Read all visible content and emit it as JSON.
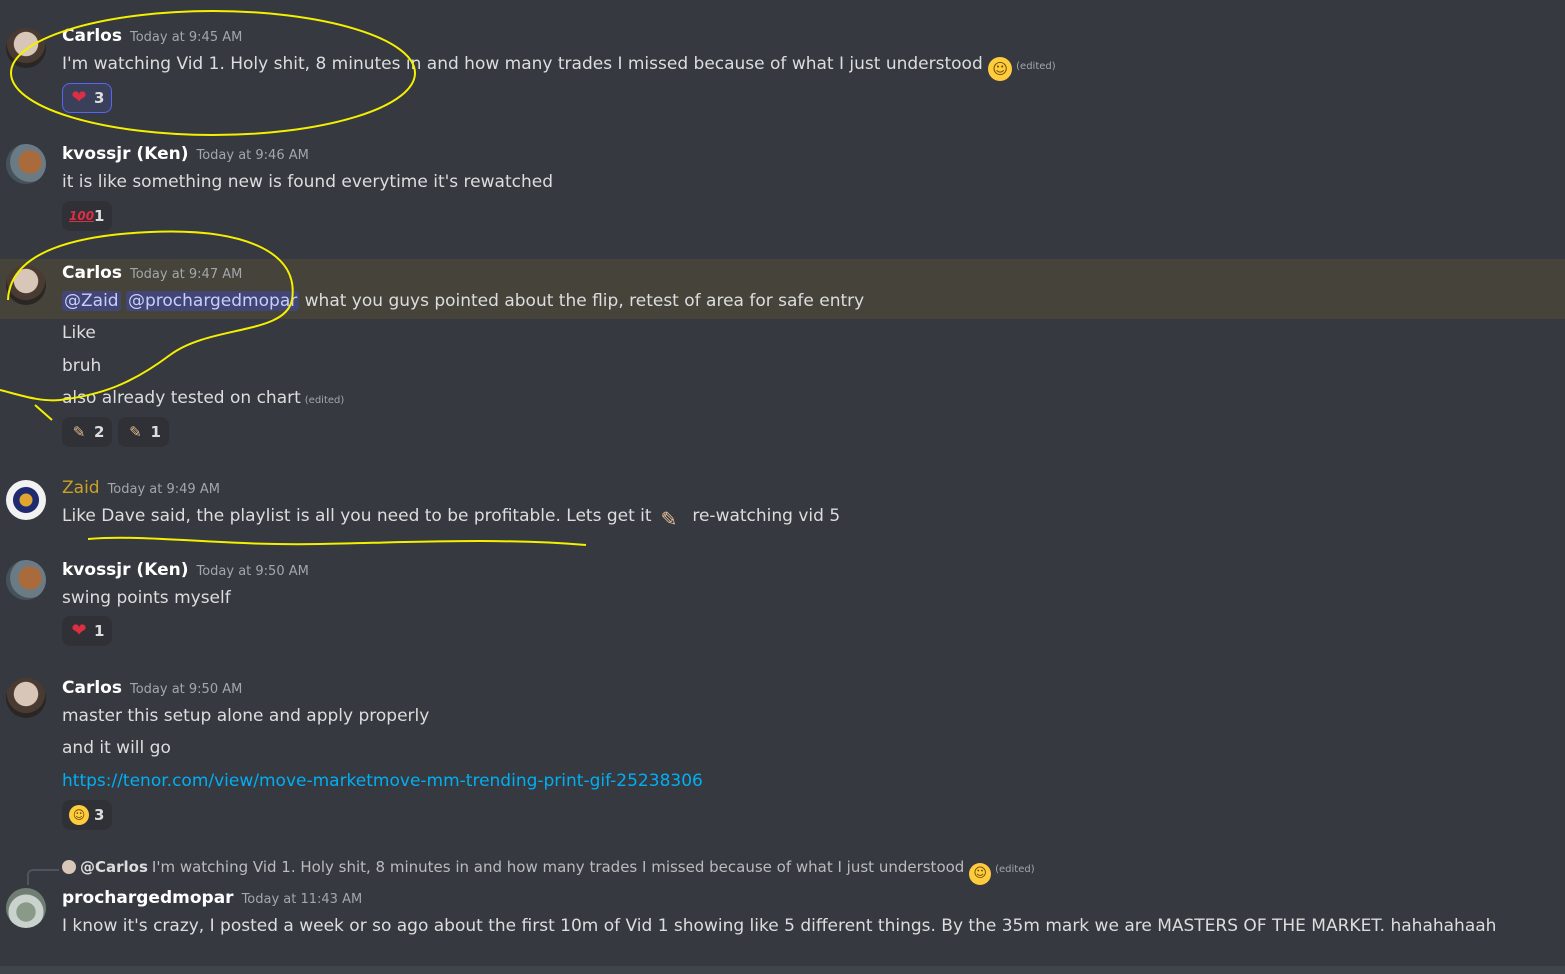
{
  "messages": [
    {
      "author": "Carlos",
      "timestamp": "Today at 9:45 AM",
      "text": "I'm watching Vid 1. Holy shit, 8 minutes in and how many trades I missed because of what I just understood",
      "emoji": "rolling-on-floor-laughing",
      "edited": "(edited)",
      "reactions": [
        {
          "emoji": "heart",
          "count": "3"
        }
      ]
    },
    {
      "author": "kvossjr (Ken)",
      "timestamp": "Today at 9:46 AM",
      "text": "it is like something new is found everytime it's rewatched",
      "reactions": [
        {
          "emoji": "hundred-points",
          "glyph": "100",
          "count": "1"
        }
      ]
    },
    {
      "author": "Carlos",
      "timestamp": "Today at 9:47 AM",
      "mentions": [
        "@Zaid",
        "@prochargedmopar"
      ],
      "text": " what you guys pointed about the flip, retest of area for safe entry",
      "lines": [
        "Like",
        "bruh",
        "also already tested on chart"
      ],
      "edited": "(edited)",
      "reactions": [
        {
          "emoji": "flexed-biceps",
          "count": "2"
        },
        {
          "emoji": "flexed-biceps-alt",
          "count": "1"
        }
      ]
    },
    {
      "author": "Zaid",
      "timestamp": "Today at 9:49 AM",
      "text": "Like Dave said, the playlist is all you need to be profitable. Lets get it",
      "emoji": "flexed-biceps",
      "text_after": "re-watching vid 5"
    },
    {
      "author": "kvossjr (Ken)",
      "timestamp": "Today at 9:50 AM",
      "text": "swing points myself",
      "reactions": [
        {
          "emoji": "heart",
          "count": "1"
        }
      ]
    },
    {
      "author": "Carlos",
      "timestamp": "Today at 9:50 AM",
      "lines": [
        "master this setup alone and apply properly",
        "and it will go"
      ],
      "link": "https://tenor.com/view/move-marketmove-mm-trending-print-gif-25238306",
      "reactions": [
        {
          "emoji": "face-with-tears-of-joy",
          "count": "3"
        }
      ]
    },
    {
      "reply_to": {
        "name": "@Carlos",
        "text": "I'm watching Vid 1. Holy shit, 8 minutes in and how many trades I missed because of what I just understood",
        "edited": "(edited)"
      },
      "author": "prochargedmopar",
      "timestamp": "Today at 11:43 AM",
      "text": "I know it's crazy, I posted a week or so ago about the first 10m of Vid 1 showing like 5 different things. By the 35m mark we are MASTERS OF THE MARKET.  hahahahaah"
    }
  ],
  "annotation_color": "#f5f000"
}
